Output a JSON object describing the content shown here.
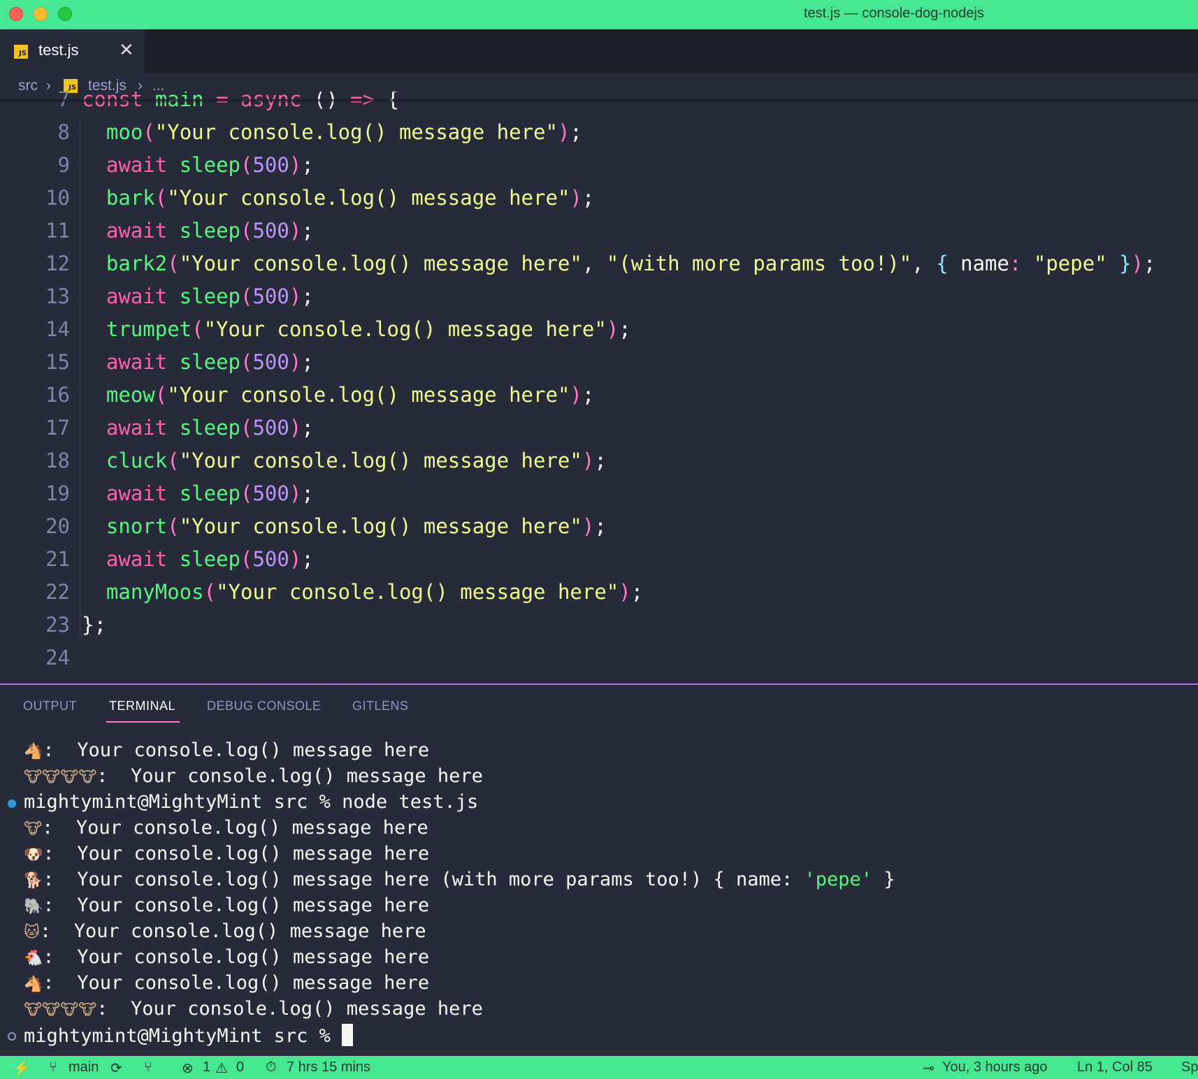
{
  "window": {
    "title": "test.js — console-dog-nodejs"
  },
  "tab": {
    "name": "test.js",
    "icon": "js-file-icon"
  },
  "breadcrumb": {
    "folder": "src",
    "file": "test.js",
    "more": "..."
  },
  "editor": {
    "lines": [
      {
        "n": "7",
        "tokens": [
          [
            "kw",
            "const "
          ],
          [
            "fn",
            "main "
          ],
          [
            "kw",
            "= async "
          ],
          [
            "pn",
            "() "
          ],
          [
            "kw",
            "=> "
          ],
          [
            "pn",
            "{"
          ]
        ]
      },
      {
        "n": "8",
        "tokens": [
          [
            "fn",
            "  moo"
          ],
          [
            "pr",
            "("
          ],
          [
            "str",
            "\"Your console.log() message here\""
          ],
          [
            "pr",
            ")"
          ],
          [
            "pn",
            ";"
          ]
        ]
      },
      {
        "n": "9",
        "tokens": [
          [
            "kw",
            "  await "
          ],
          [
            "fn",
            "sleep"
          ],
          [
            "pr",
            "("
          ],
          [
            "num",
            "500"
          ],
          [
            "pr",
            ")"
          ],
          [
            "pn",
            ";"
          ]
        ]
      },
      {
        "n": "10",
        "tokens": [
          [
            "fn",
            "  bark"
          ],
          [
            "pr",
            "("
          ],
          [
            "str",
            "\"Your console.log() message here\""
          ],
          [
            "pr",
            ")"
          ],
          [
            "pn",
            ";"
          ]
        ]
      },
      {
        "n": "11",
        "tokens": [
          [
            "kw",
            "  await "
          ],
          [
            "fn",
            "sleep"
          ],
          [
            "pr",
            "("
          ],
          [
            "num",
            "500"
          ],
          [
            "pr",
            ")"
          ],
          [
            "pn",
            ";"
          ]
        ]
      },
      {
        "n": "12",
        "tokens": [
          [
            "fn",
            "  bark2"
          ],
          [
            "pr",
            "("
          ],
          [
            "str",
            "\"Your console.log() message here\""
          ],
          [
            "pn",
            ", "
          ],
          [
            "str",
            "\"(with more params too!)\""
          ],
          [
            "pn",
            ", "
          ],
          [
            "br",
            "{ "
          ],
          [
            "pn",
            "name"
          ],
          [
            "pr",
            ": "
          ],
          [
            "str",
            "\"pepe\" "
          ],
          [
            "br",
            "}"
          ],
          [
            "pr",
            ")"
          ],
          [
            "pn",
            ";"
          ]
        ]
      },
      {
        "n": "13",
        "tokens": [
          [
            "kw",
            "  await "
          ],
          [
            "fn",
            "sleep"
          ],
          [
            "pr",
            "("
          ],
          [
            "num",
            "500"
          ],
          [
            "pr",
            ")"
          ],
          [
            "pn",
            ";"
          ]
        ]
      },
      {
        "n": "14",
        "tokens": [
          [
            "fn",
            "  trumpet"
          ],
          [
            "pr",
            "("
          ],
          [
            "str",
            "\"Your console.log() message here\""
          ],
          [
            "pr",
            ")"
          ],
          [
            "pn",
            ";"
          ]
        ]
      },
      {
        "n": "15",
        "tokens": [
          [
            "kw",
            "  await "
          ],
          [
            "fn",
            "sleep"
          ],
          [
            "pr",
            "("
          ],
          [
            "num",
            "500"
          ],
          [
            "pr",
            ")"
          ],
          [
            "pn",
            ";"
          ]
        ]
      },
      {
        "n": "16",
        "tokens": [
          [
            "fn",
            "  meow"
          ],
          [
            "pr",
            "("
          ],
          [
            "str",
            "\"Your console.log() message here\""
          ],
          [
            "pr",
            ")"
          ],
          [
            "pn",
            ";"
          ]
        ]
      },
      {
        "n": "17",
        "tokens": [
          [
            "kw",
            "  await "
          ],
          [
            "fn",
            "sleep"
          ],
          [
            "pr",
            "("
          ],
          [
            "num",
            "500"
          ],
          [
            "pr",
            ")"
          ],
          [
            "pn",
            ";"
          ]
        ]
      },
      {
        "n": "18",
        "tokens": [
          [
            "fn",
            "  cluck"
          ],
          [
            "pr",
            "("
          ],
          [
            "str",
            "\"Your console.log() message here\""
          ],
          [
            "pr",
            ")"
          ],
          [
            "pn",
            ";"
          ]
        ]
      },
      {
        "n": "19",
        "tokens": [
          [
            "kw",
            "  await "
          ],
          [
            "fn",
            "sleep"
          ],
          [
            "pr",
            "("
          ],
          [
            "num",
            "500"
          ],
          [
            "pr",
            ")"
          ],
          [
            "pn",
            ";"
          ]
        ]
      },
      {
        "n": "20",
        "tokens": [
          [
            "fn",
            "  snort"
          ],
          [
            "pr",
            "("
          ],
          [
            "str",
            "\"Your console.log() message here\""
          ],
          [
            "pr",
            ")"
          ],
          [
            "pn",
            ";"
          ]
        ]
      },
      {
        "n": "21",
        "tokens": [
          [
            "kw",
            "  await "
          ],
          [
            "fn",
            "sleep"
          ],
          [
            "pr",
            "("
          ],
          [
            "num",
            "500"
          ],
          [
            "pr",
            ")"
          ],
          [
            "pn",
            ";"
          ]
        ]
      },
      {
        "n": "22",
        "tokens": [
          [
            "fn",
            "  manyMoos"
          ],
          [
            "pr",
            "("
          ],
          [
            "str",
            "\"Your console.log() message here\""
          ],
          [
            "pr",
            ")"
          ],
          [
            "pn",
            ";"
          ]
        ]
      },
      {
        "n": "23",
        "tokens": [
          [
            "pn",
            "};"
          ]
        ]
      },
      {
        "n": "24",
        "tokens": []
      }
    ]
  },
  "panel": {
    "tabs": [
      {
        "label": "OUTPUT",
        "active": false
      },
      {
        "label": "TERMINAL",
        "active": true
      },
      {
        "label": "DEBUG CONSOLE",
        "active": false
      },
      {
        "label": "GITLENS",
        "active": false
      }
    ]
  },
  "terminal": {
    "lines": [
      {
        "icon": "horse-icon",
        "glyph": "🐴",
        "sep": ":  ",
        "text": "Your console.log() message here"
      },
      {
        "icon": "many-cows-icon",
        "glyph": "🐮🐮🐮🐮",
        "sep": ":  ",
        "text": "Your console.log() message here"
      },
      {
        "marker": "filled",
        "prompt": "mightymint@MightyMint src % ",
        "text": "node test.js"
      },
      {
        "icon": "cow-icon",
        "glyph": "🐮",
        "sep": ":  ",
        "text": "Your console.log() message here"
      },
      {
        "icon": "dog-icon",
        "glyph": "🐶",
        "sep": ":  ",
        "text": "Your console.log() message here"
      },
      {
        "icon": "dog2-icon",
        "glyph": "🐕",
        "sep": ":  ",
        "text": "Your console.log() message here (with more params too!) { name: ",
        "green": "'pepe'",
        "tail": " }"
      },
      {
        "icon": "elephant-icon",
        "glyph": "🐘",
        "sep": ":  ",
        "text": "Your console.log() message here"
      },
      {
        "icon": "cat-icon",
        "glyph": "🐱",
        "sep": ":  ",
        "text": "Your console.log() message here"
      },
      {
        "icon": "chicken-icon",
        "glyph": "🐔",
        "sep": ":  ",
        "text": "Your console.log() message here"
      },
      {
        "icon": "horse-icon",
        "glyph": "🐴",
        "sep": ":  ",
        "text": "Your console.log() message here"
      },
      {
        "icon": "many-cows-icon",
        "glyph": "🐮🐮🐮🐮",
        "sep": ":  ",
        "text": "Your console.log() message here"
      },
      {
        "marker": "hollow",
        "prompt": "mightymint@MightyMint src % ",
        "text": "",
        "cursor": true
      }
    ]
  },
  "status": {
    "branch": "main",
    "errors": "1",
    "warnings": "0",
    "time": "7 hrs 15 mins",
    "blame": "You, 3 hours ago",
    "position": "Ln 1, Col 85",
    "spaces": "Sp"
  },
  "colors": {
    "accent": "#45e792",
    "background": "#262a39",
    "keyword": "#ff5fa9",
    "function": "#50fa7b",
    "string": "#f1fa8c",
    "number": "#bd93f9"
  }
}
